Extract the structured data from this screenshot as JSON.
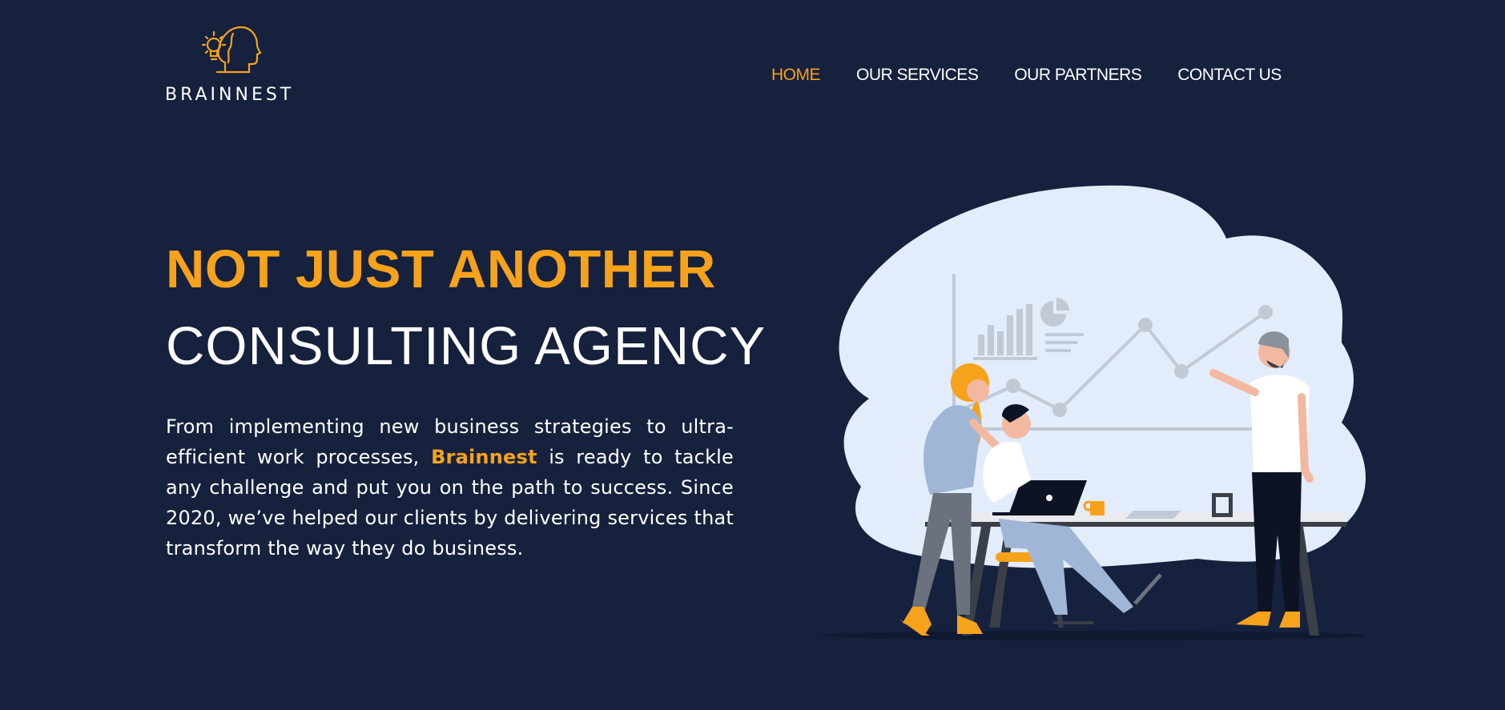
{
  "brand": {
    "name": "BRAINNEST",
    "logo_icon": "lightbulb-head-icon",
    "accent_color": "#f6a21b",
    "background_color": "#15213d"
  },
  "nav": {
    "items": [
      {
        "label": "HOME",
        "active": true
      },
      {
        "label": "OUR SERVICES",
        "active": false
      },
      {
        "label": "OUR PARTNERS",
        "active": false
      },
      {
        "label": "CONTACT US",
        "active": false
      }
    ]
  },
  "hero": {
    "title_line_1": "NOT JUST ANOTHER",
    "title_line_2": "CONSULTING AGENCY",
    "text_before": "From implementing new business strategies to ultra-efficient work processes,",
    "text_brand": "Brainnest",
    "text_after": "is ready to tackle any challenge and put you on the path to success. Since 2020, we’ve helped our clients by delivering services that transform the way they do business."
  },
  "illustration": {
    "name": "team-meeting-illustration"
  }
}
